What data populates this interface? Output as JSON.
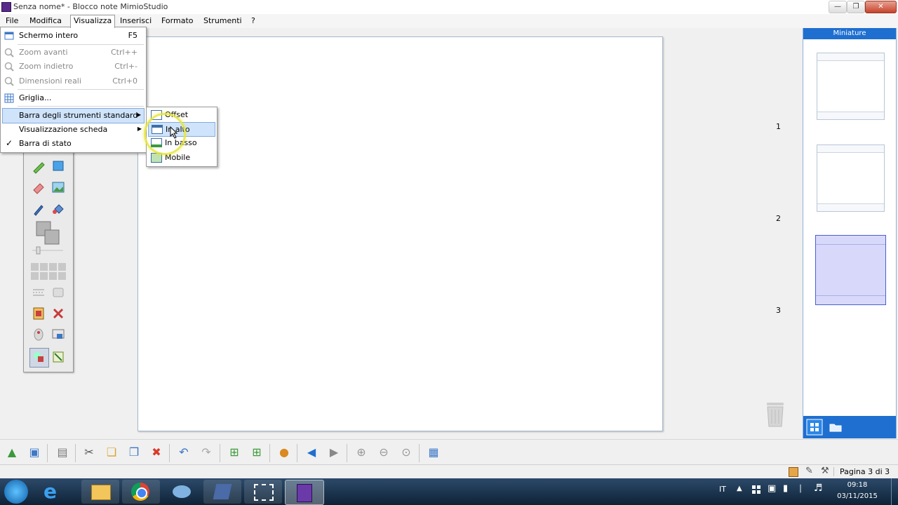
{
  "window": {
    "title": "Senza nome* - Blocco note MimioStudio"
  },
  "menubar": [
    "File",
    "Modifica",
    "Visualizza",
    "Inserisci",
    "Formato",
    "Strumenti",
    "?"
  ],
  "view_menu": {
    "items": [
      {
        "label": "Schermo intero",
        "shortcut": "F5",
        "disabled": false
      },
      {
        "label": "Zoom avanti",
        "shortcut": "Ctrl++",
        "disabled": true
      },
      {
        "label": "Zoom indietro",
        "shortcut": "Ctrl+-",
        "disabled": true
      },
      {
        "label": "Dimensioni reali",
        "shortcut": "Ctrl+0",
        "disabled": true
      },
      {
        "label": "Griglia...",
        "shortcut": "",
        "disabled": false
      },
      {
        "label": "Barra degli strumenti standard",
        "shortcut": "",
        "submenu": true,
        "highlighted": true
      },
      {
        "label": "Visualizzazione scheda",
        "shortcut": "",
        "submenu": true
      },
      {
        "label": "Barra di stato",
        "shortcut": "",
        "checked": true
      }
    ]
  },
  "toolbar_submenu": {
    "items": [
      "Offset",
      "In alto",
      "In basso",
      "Mobile"
    ],
    "highlighted": "In alto"
  },
  "thumbnails": {
    "header": "Miniature",
    "pages": [
      "1",
      "2",
      "3"
    ],
    "selected": "3"
  },
  "statusbar": {
    "page_label": "Pagina 3 di 3"
  },
  "taskbar": {
    "language": "IT",
    "time": "09:18",
    "date": "03/11/2015"
  },
  "colors": {
    "accent": "#1e6fd0",
    "menu_highlight": "#cfe3fb",
    "selected_thumb": "#d8d8fb"
  }
}
